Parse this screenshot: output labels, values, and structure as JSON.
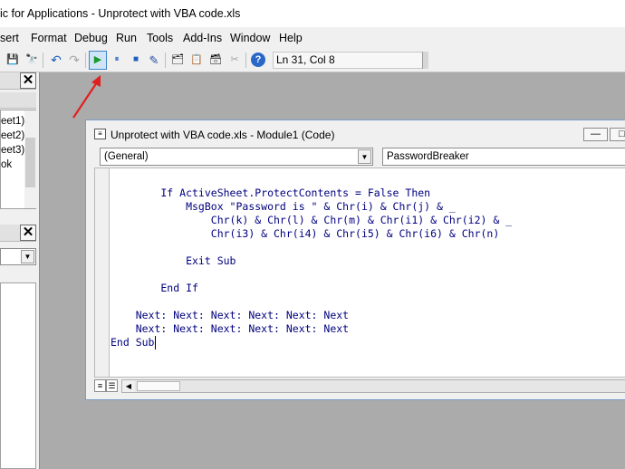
{
  "window": {
    "title": "ic for Applications - Unprotect with VBA code.xls"
  },
  "menu": [
    {
      "label": "sert"
    },
    {
      "label": "Format"
    },
    {
      "label": "Debug"
    },
    {
      "label": "Run"
    },
    {
      "label": "Tools"
    },
    {
      "label": "Add-Ins"
    },
    {
      "label": "Window"
    },
    {
      "label": "Help"
    }
  ],
  "toolbar": {
    "status": "Ln 31, Col 8",
    "icons": {
      "save": "💾",
      "find": "🔭",
      "undo": "↶",
      "redo": "↷",
      "run": "▶",
      "pause": "⏸",
      "stop": "■",
      "design": "✎",
      "project": "🗂",
      "properties": "📋",
      "object_browser": "🗃",
      "toolbox": "✂",
      "help": "?"
    }
  },
  "left_panel": {
    "project_items": [
      "eet1)",
      "eet2)",
      "eet3)",
      "ok"
    ],
    "close_glyph": "✕"
  },
  "code_window": {
    "title": "Unprotect with VBA code.xls - Module1 (Code)",
    "object_combo": "(General)",
    "procedure_combo": "PasswordBreaker",
    "code_lines": [
      "        If ActiveSheet.ProtectContents = False Then",
      "            MsgBox \"Password is \" & Chr(i) & Chr(j) & _",
      "                Chr(k) & Chr(l) & Chr(m) & Chr(i1) & Chr(i2) & _",
      "                Chr(i3) & Chr(i4) & Chr(i5) & Chr(i6) & Chr(n)",
      "",
      "            Exit Sub",
      "",
      "        End If",
      "",
      "    Next: Next: Next: Next: Next: Next",
      "    Next: Next: Next: Next: Next: Next",
      "End Sub"
    ]
  },
  "colors": {
    "code_text": "#00007f",
    "arrow": "#e02020",
    "run_highlight": "#cfe5f7",
    "run_glyph": "#1a9a2a"
  }
}
